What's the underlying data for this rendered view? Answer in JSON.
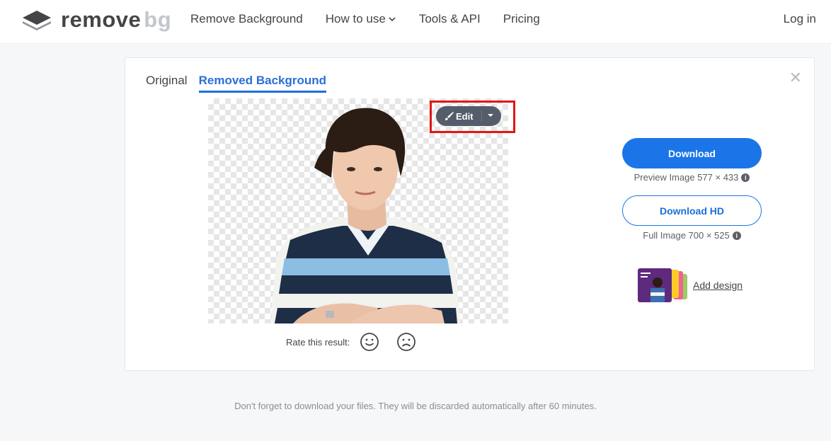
{
  "header": {
    "logo_remove": "remove",
    "logo_bg": "bg",
    "nav": [
      {
        "label": "Remove Background"
      },
      {
        "label": "How to use",
        "has_dropdown": true
      },
      {
        "label": "Tools & API"
      },
      {
        "label": "Pricing"
      }
    ],
    "login_label": "Log in"
  },
  "result": {
    "tabs": [
      {
        "label": "Original",
        "active": false
      },
      {
        "label": "Removed Background",
        "active": true
      }
    ],
    "close_icon": "close-icon",
    "edit_label": "Edit",
    "rate_label": "Rate this result:"
  },
  "downloads": {
    "download_label": "Download",
    "preview_info": "Preview Image 577 × 433",
    "download_hd_label": "Download HD",
    "full_info": "Full Image 700 × 525",
    "add_design_label": "Add design"
  },
  "footer": {
    "note": "Don't forget to download your files. They will be discarded automatically after 60 minutes."
  },
  "colors": {
    "accent": "#1b75e8",
    "highlight": "#e01616",
    "edit_pill": "#545d69"
  }
}
